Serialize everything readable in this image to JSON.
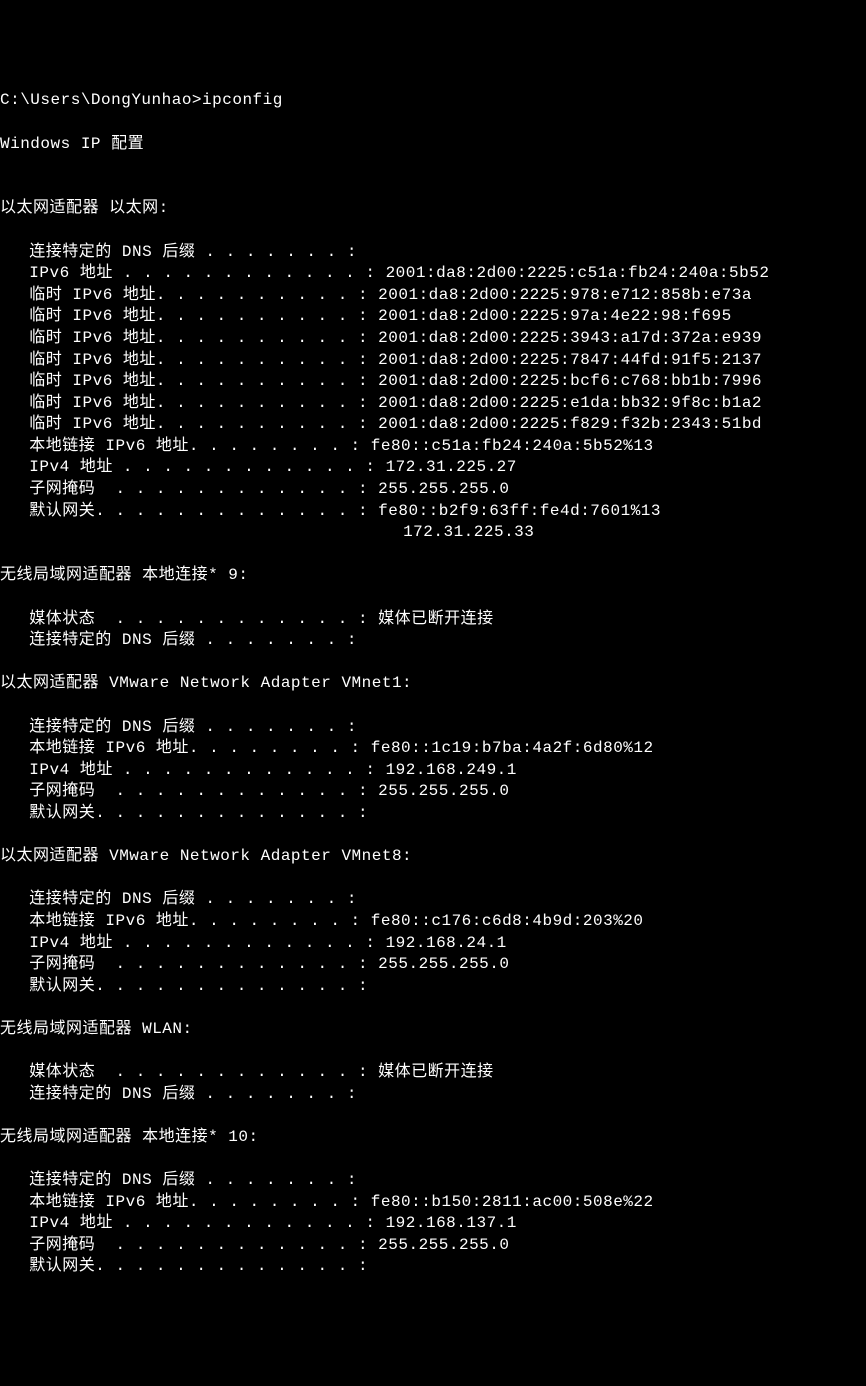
{
  "prompt": "C:\\Users\\DongYunhao>ipconfig",
  "header": "Windows IP 配置",
  "adapters": [
    {
      "title": "以太网适配器 以太网:",
      "props": [
        {
          "label": " 连接特定的 DNS 后缀 . . . . . . . :",
          "value": ""
        },
        {
          "label": " IPv6 地址 . . . . . . . . . . . . : ",
          "value": "2001:da8:2d00:2225:c51a:fb24:240a:5b52"
        },
        {
          "label": " 临时 IPv6 地址. . . . . . . . . . : ",
          "value": "2001:da8:2d00:2225:978:e712:858b:e73a"
        },
        {
          "label": " 临时 IPv6 地址. . . . . . . . . . : ",
          "value": "2001:da8:2d00:2225:97a:4e22:98:f695"
        },
        {
          "label": " 临时 IPv6 地址. . . . . . . . . . : ",
          "value": "2001:da8:2d00:2225:3943:a17d:372a:e939"
        },
        {
          "label": " 临时 IPv6 地址. . . . . . . . . . : ",
          "value": "2001:da8:2d00:2225:7847:44fd:91f5:2137"
        },
        {
          "label": " 临时 IPv6 地址. . . . . . . . . . : ",
          "value": "2001:da8:2d00:2225:bcf6:c768:bb1b:7996"
        },
        {
          "label": " 临时 IPv6 地址. . . . . . . . . . : ",
          "value": "2001:da8:2d00:2225:e1da:bb32:9f8c:b1a2"
        },
        {
          "label": " 临时 IPv6 地址. . . . . . . . . . : ",
          "value": "2001:da8:2d00:2225:f829:f32b:2343:51bd"
        },
        {
          "label": " 本地链接 IPv6 地址. . . . . . . . : ",
          "value": "fe80::c51a:fb24:240a:5b52%13"
        },
        {
          "label": " IPv4 地址 . . . . . . . . . . . . : ",
          "value": "172.31.225.27"
        },
        {
          "label": " 子网掩码  . . . . . . . . . . . . : ",
          "value": "255.255.255.0"
        },
        {
          "label": " 默认网关. . . . . . . . . . . . . : ",
          "value": "fe80::b2f9:63ff:fe4d:7601%13"
        }
      ],
      "extra": {
        "pad": "                                      ",
        "value": "172.31.225.33"
      }
    },
    {
      "title": "无线局域网适配器 本地连接* 9:",
      "props": [
        {
          "label": " 媒体状态  . . . . . . . . . . . . : ",
          "value": "媒体已断开连接"
        },
        {
          "label": " 连接特定的 DNS 后缀 . . . . . . . :",
          "value": ""
        }
      ]
    },
    {
      "title": "以太网适配器 VMware Network Adapter VMnet1:",
      "props": [
        {
          "label": " 连接特定的 DNS 后缀 . . . . . . . :",
          "value": ""
        },
        {
          "label": " 本地链接 IPv6 地址. . . . . . . . : ",
          "value": "fe80::1c19:b7ba:4a2f:6d80%12"
        },
        {
          "label": " IPv4 地址 . . . . . . . . . . . . : ",
          "value": "192.168.249.1"
        },
        {
          "label": " 子网掩码  . . . . . . . . . . . . : ",
          "value": "255.255.255.0"
        },
        {
          "label": " 默认网关. . . . . . . . . . . . . :",
          "value": ""
        }
      ]
    },
    {
      "title": "以太网适配器 VMware Network Adapter VMnet8:",
      "props": [
        {
          "label": " 连接特定的 DNS 后缀 . . . . . . . :",
          "value": ""
        },
        {
          "label": " 本地链接 IPv6 地址. . . . . . . . : ",
          "value": "fe80::c176:c6d8:4b9d:203%20"
        },
        {
          "label": " IPv4 地址 . . . . . . . . . . . . : ",
          "value": "192.168.24.1"
        },
        {
          "label": " 子网掩码  . . . . . . . . . . . . : ",
          "value": "255.255.255.0"
        },
        {
          "label": " 默认网关. . . . . . . . . . . . . :",
          "value": ""
        }
      ]
    },
    {
      "title": "无线局域网适配器 WLAN:",
      "props": [
        {
          "label": " 媒体状态  . . . . . . . . . . . . : ",
          "value": "媒体已断开连接"
        },
        {
          "label": " 连接特定的 DNS 后缀 . . . . . . . :",
          "value": ""
        }
      ]
    },
    {
      "title": "无线局域网适配器 本地连接* 10:",
      "props": [
        {
          "label": " 连接特定的 DNS 后缀 . . . . . . . :",
          "value": ""
        },
        {
          "label": " 本地链接 IPv6 地址. . . . . . . . : ",
          "value": "fe80::b150:2811:ac00:508e%22"
        },
        {
          "label": " IPv4 地址 . . . . . . . . . . . . : ",
          "value": "192.168.137.1"
        },
        {
          "label": " 子网掩码  . . . . . . . . . . . . : ",
          "value": "255.255.255.0"
        },
        {
          "label": " 默认网关. . . . . . . . . . . . . :",
          "value": ""
        }
      ]
    }
  ]
}
